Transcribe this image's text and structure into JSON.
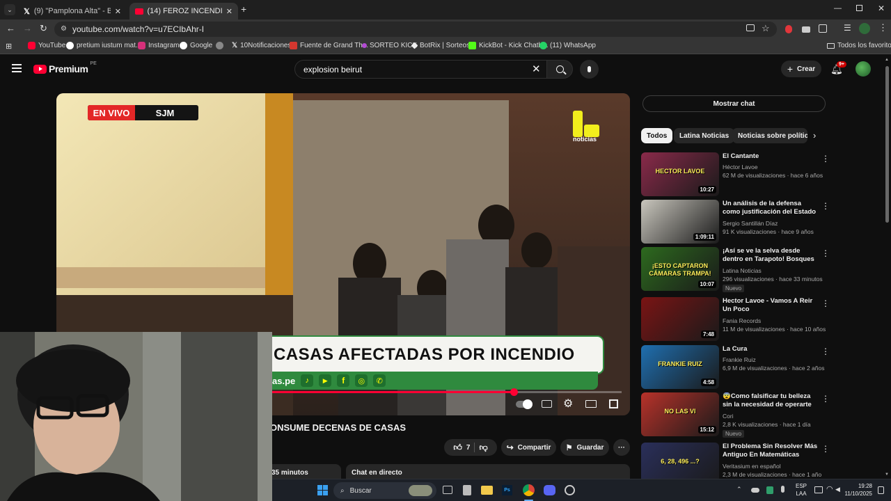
{
  "browser": {
    "tabs": [
      {
        "title": "(9) \"Pamplona Alta\" - Buscar / X",
        "icon": "x-logo-icon"
      },
      {
        "title": "(14) FEROZ INCENDIO EN SAN",
        "icon": "youtube-icon"
      }
    ],
    "new_tab": "+",
    "url": "youtube.com/watch?v=u7ECIbAhr-I",
    "bookmarks": [
      "YouTube",
      "pretium iustum mat...",
      "Instagram",
      "Google",
      "",
      "10Notificaciones",
      "Fuente de Grand Th...",
      "SORTEO KICK",
      "BotRix | Sorteos",
      "KickBot - Kick Chatb...",
      "(11) WhatsApp"
    ],
    "all_favorites": "Todos los favoritos"
  },
  "youtube": {
    "logo_text": "Premium",
    "region": "PE",
    "search_value": "explosion beirut",
    "create_label": "Crear",
    "notif_count": "9+"
  },
  "player": {
    "live_label": "EN VIVO",
    "location_label": "SJM",
    "channel_logo": "noticias",
    "banner_headline": "CASAS AFECTADAS POR INCENDIO",
    "banner_site": "as.pe",
    "progress_fraction": 0.806
  },
  "video": {
    "title_visible": "ONSUME DECENAS DE CASAS",
    "likes": "7",
    "share_label": "Compartir",
    "save_label": "Guardar",
    "more": "···",
    "time_fragment": "35 minutos",
    "live_chat_label": "Chat en directo"
  },
  "sidebar": {
    "show_chat": "Mostrar chat",
    "chips": [
      "Todos",
      "Latina Noticias",
      "Noticias sobre política"
    ],
    "recommendations": [
      {
        "title": "El Cantante",
        "channel": "Héctor Lavoe",
        "meta": "62 M de visualizaciones · hace 6 años",
        "duration": "10:27",
        "badge": "",
        "thumb_color": "#8a2a4a",
        "thumb_text": "HECTOR LAVOE"
      },
      {
        "title": "Un análisis de la defensa como justificación del Estado | Migu...",
        "channel": "Sergio Santillán Díaz",
        "meta": "91 K visualizaciones · hace 9 años",
        "duration": "1:09:11",
        "badge": "",
        "thumb_color": "#c9c6bd",
        "thumb_text": ""
      },
      {
        "title": "¡Así se ve la selva desde dentro en Tarapoto! Bosques ...",
        "channel": "Latina Noticias",
        "meta": "296 visualizaciones · hace 33 minutos",
        "duration": "10:07",
        "badge": "Nuevo",
        "thumb_color": "#2d6a1e",
        "thumb_text": "¡ESTO CAPTARON CÁMARAS TRAMPA!"
      },
      {
        "title": "Hector Lavoe - Vamos A Reir Un Poco",
        "channel": "Fania Records",
        "meta": "11 M de visualizaciones · hace 10 años",
        "duration": "7:48",
        "badge": "",
        "thumb_color": "#7a1414",
        "thumb_text": ""
      },
      {
        "title": "La Cura",
        "channel": "Frankie Ruiz",
        "meta": "6,9 M de visualizaciones · hace 2 años",
        "duration": "4:58",
        "badge": "",
        "thumb_color": "#1f6fb0",
        "thumb_text": "FRANKIE RUIZ"
      },
      {
        "title": "😨Como falsificar tu belleza sin la necesidad de operarte 😨",
        "channel": "Cori",
        "meta": "2,8 K visualizaciones · hace 1 día",
        "duration": "15:12",
        "badge": "Nuevo",
        "thumb_color": "#b8322a",
        "thumb_text": "NO LAS VI"
      },
      {
        "title": "El Problema Sin Resolver Más Antiguo En Matemáticas",
        "channel": "Veritasium en español",
        "meta": "2,3 M de visualizaciones · hace 1 año",
        "duration": "",
        "badge": "",
        "thumb_color": "#2a2f5a",
        "thumb_text": "6, 28, 496 ...?"
      }
    ]
  },
  "taskbar": {
    "search_label": "Buscar",
    "lang": "ESP",
    "lang2": "LAA",
    "time": "19:28",
    "date": "11/10/2025"
  },
  "colors": {
    "youtube_red": "#ff0033",
    "live_red": "#e32727",
    "banner_green": "#2f8a3e"
  }
}
